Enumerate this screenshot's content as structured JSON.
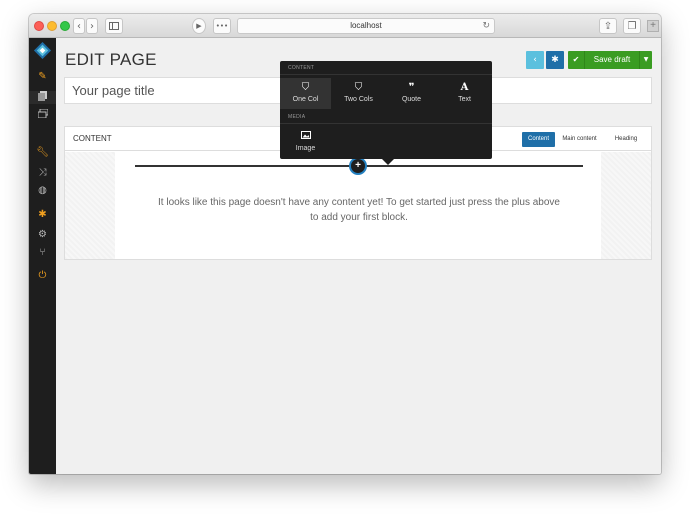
{
  "browser": {
    "url": "localhost"
  },
  "page": {
    "heading": "EDIT PAGE",
    "title_placeholder": "Your page title"
  },
  "toolbar": {
    "save_label": "Save draft"
  },
  "panel": {
    "label": "CONTENT",
    "tabs": [
      "Content",
      "Main content",
      "Heading"
    ],
    "empty_message": "It looks like this page doesn't have any content yet! To get started just press the plus above to add your first block."
  },
  "popover": {
    "sections": [
      {
        "label": "CONTENT",
        "items": [
          {
            "label": "One Col",
            "icon": "html5-icon"
          },
          {
            "label": "Two Cols",
            "icon": "html5-icon"
          },
          {
            "label": "Quote",
            "icon": "quote-icon"
          },
          {
            "label": "Text",
            "icon": "text-a-icon"
          }
        ]
      },
      {
        "label": "MEDIA",
        "items": [
          {
            "label": "Image",
            "icon": "image-icon"
          }
        ]
      }
    ]
  },
  "colors": {
    "accent_blue": "#1f6fa8",
    "light_blue": "#5bc0de",
    "save_green": "#3a9c22",
    "sidebar_orange": "#f0a020",
    "sidebar_dark": "#1e1e1e"
  }
}
